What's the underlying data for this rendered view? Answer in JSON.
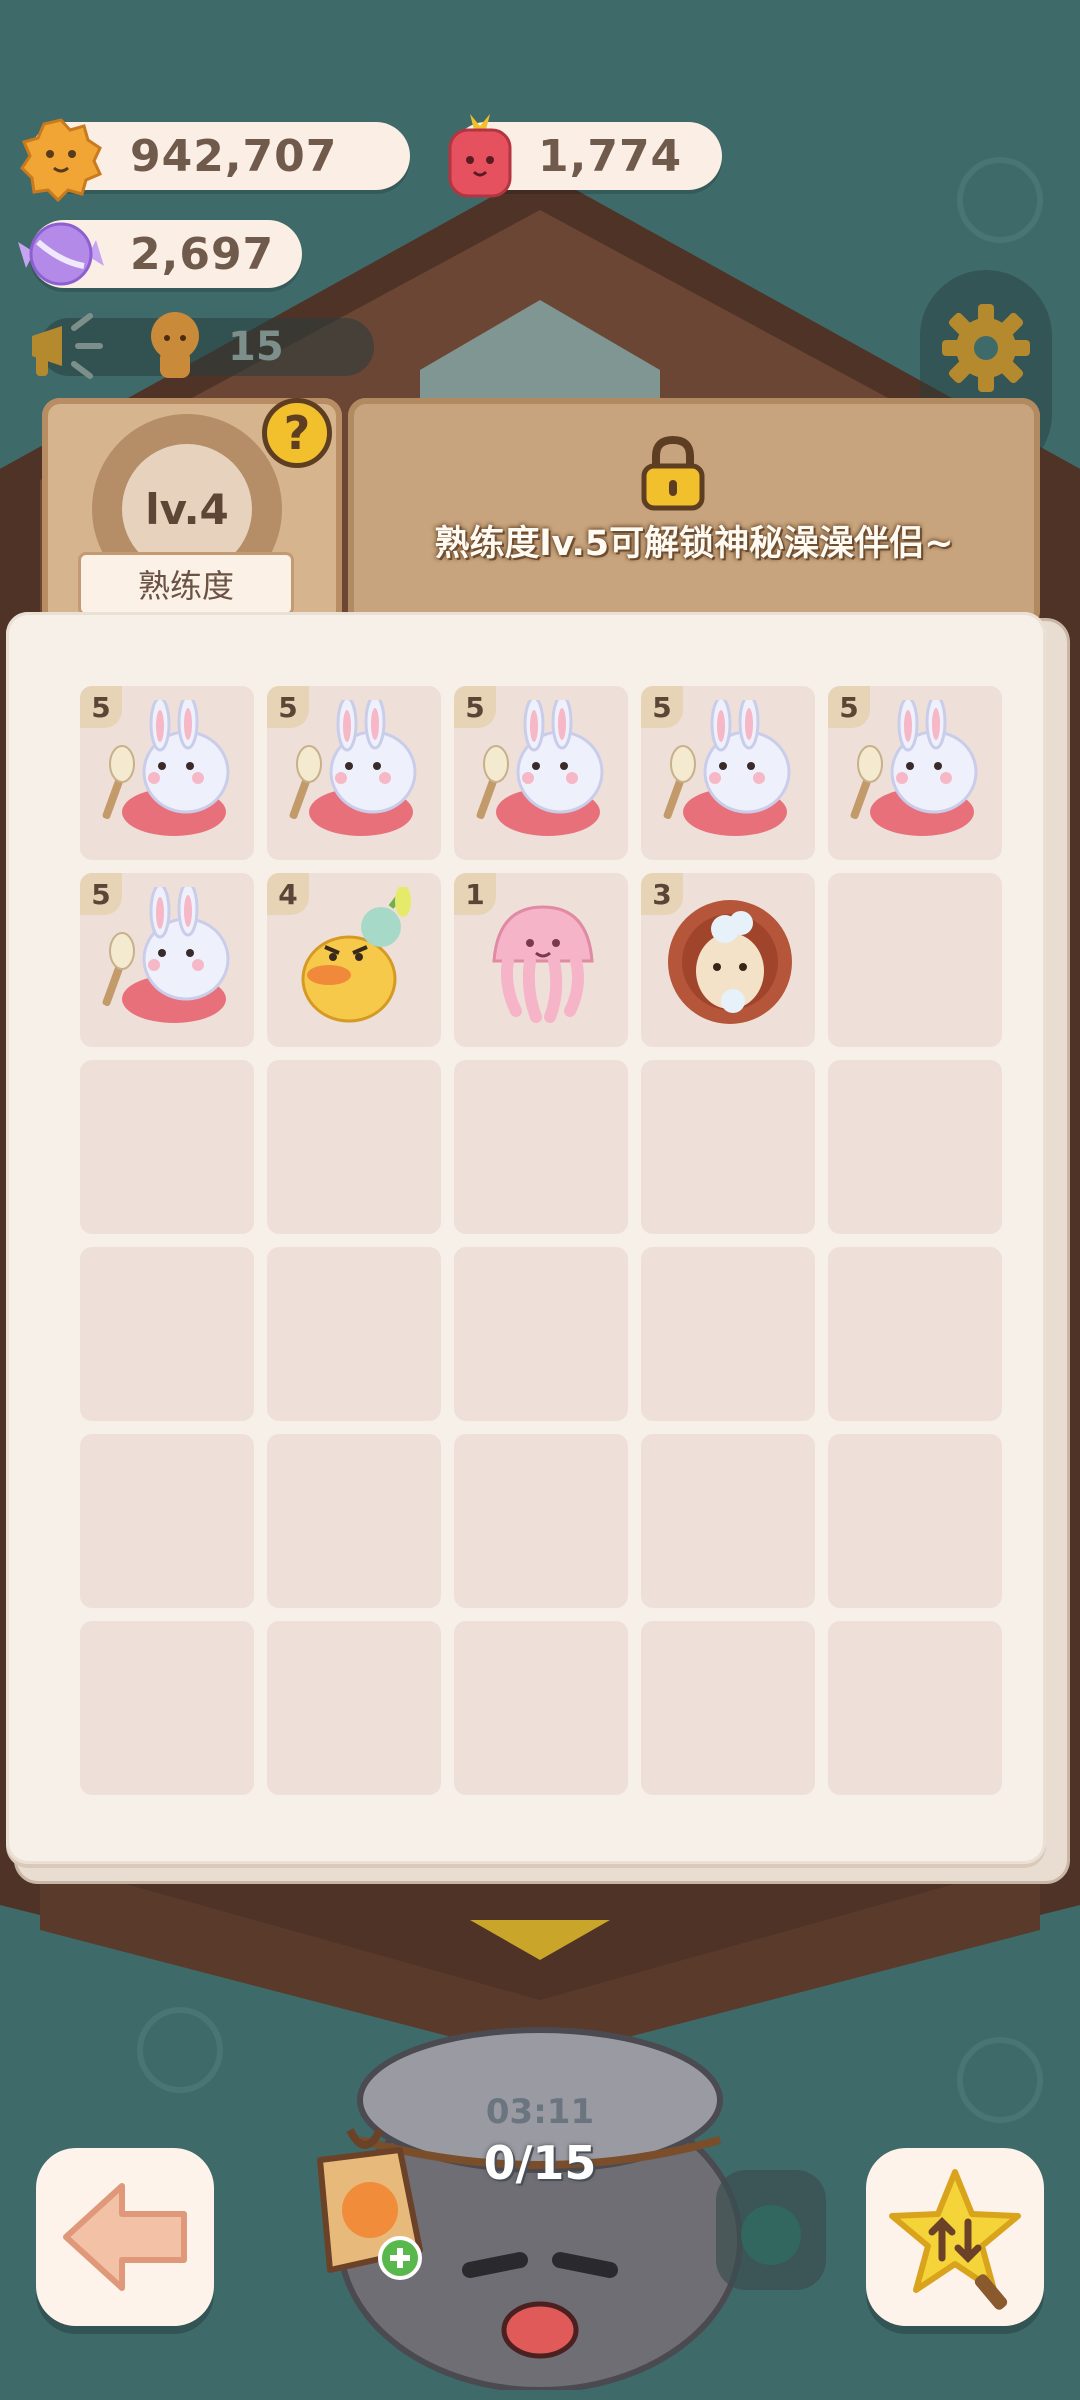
{
  "currencies": {
    "cookies": {
      "value": "942,707",
      "icon": "cookie-icon"
    },
    "jam": {
      "value": "1,774",
      "icon": "jam-jar-icon"
    },
    "candy": {
      "value": "2,697",
      "icon": "candy-icon"
    }
  },
  "announcement": {
    "count": "15",
    "icon": "megaphone-icon"
  },
  "proficiency": {
    "level": "lv.4",
    "label": "熟练度",
    "help_icon": "?"
  },
  "unlock_info": {
    "text": "熟练度lv.5可解锁神秘澡澡伴侣~",
    "icon": "lock-icon"
  },
  "grid": {
    "columns": 5,
    "rows": 6,
    "items": [
      {
        "level": "5",
        "kind": "bunny"
      },
      {
        "level": "5",
        "kind": "bunny"
      },
      {
        "level": "5",
        "kind": "bunny"
      },
      {
        "level": "5",
        "kind": "bunny"
      },
      {
        "level": "5",
        "kind": "bunny"
      },
      {
        "level": "5",
        "kind": "bunny"
      },
      {
        "level": "4",
        "kind": "duck"
      },
      {
        "level": "1",
        "kind": "jellyfish"
      },
      {
        "level": "3",
        "kind": "hedgehog"
      }
    ]
  },
  "bath_pot": {
    "timer": "03:11",
    "progress": "0/15"
  },
  "colors": {
    "background": "#3f6a6a",
    "wood": "#c7a47d",
    "paper": "#f7f0e8",
    "accent_yellow": "#f2c02c"
  }
}
